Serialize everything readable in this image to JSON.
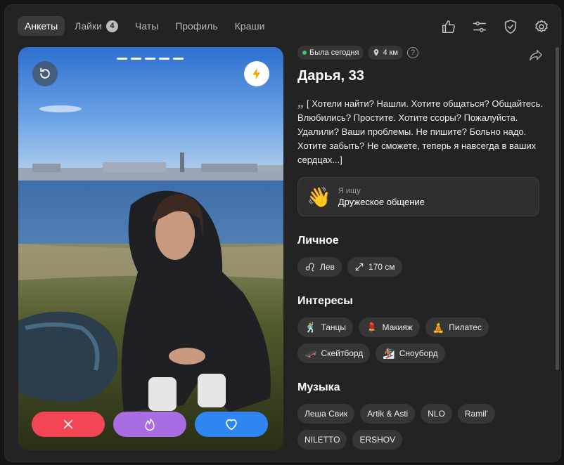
{
  "nav": {
    "tabs": [
      {
        "label": "Анкеты",
        "active": true
      },
      {
        "label": "Лайки",
        "badge": "4"
      },
      {
        "label": "Чаты"
      },
      {
        "label": "Профиль"
      },
      {
        "label": "Краши"
      }
    ],
    "icons": [
      "thumbs-up-icon",
      "sliders-icon",
      "shield-check-icon",
      "gear-icon"
    ]
  },
  "profile": {
    "status": "Была сегодня",
    "distance": "4 км",
    "help": "?",
    "name": "Дарья, 33",
    "bio": "[ Хотели найти? Нашли. Хотите общаться? Общайтесь. Влюбились? Простите. Хотите ссоры? Пожалуйста. Удалили? Ваши проблемы. Не пишите? Больно надо. Хотите забыть? Не сможете, теперь я навсегда в ваших сердцах...]",
    "quote_mark": "„",
    "seeking_label": "Я ищу",
    "seeking_value": "Дружеское общение",
    "seeking_emoji": "👋"
  },
  "photo": {
    "dots_count": 5,
    "actions": [
      "close-icon",
      "fire-icon",
      "heart-icon"
    ]
  },
  "sections": {
    "personal_title": "Личное",
    "personal": [
      {
        "icon": "leo-icon",
        "label": "Лев"
      },
      {
        "icon": "height-icon",
        "label": "170 см"
      }
    ],
    "interests_title": "Интересы",
    "interests": [
      {
        "emoji": "🕺",
        "label": "Танцы"
      },
      {
        "emoji": "💄",
        "label": "Макияж"
      },
      {
        "emoji": "🧘",
        "label": "Пилатес"
      },
      {
        "emoji": "🛹",
        "label": "Скейтборд"
      },
      {
        "emoji": "🏂",
        "label": "Сноуборд"
      }
    ],
    "music_title": "Музыка",
    "music": [
      "Леша Свик",
      "Artik & Asti",
      "NLO",
      "Ramil'",
      "NILETTO",
      "ERSHOV"
    ]
  },
  "colors": {
    "dislike": "#f44555",
    "superlike": "#a86ce3",
    "like": "#2f86f0",
    "online": "#3ec46d"
  }
}
